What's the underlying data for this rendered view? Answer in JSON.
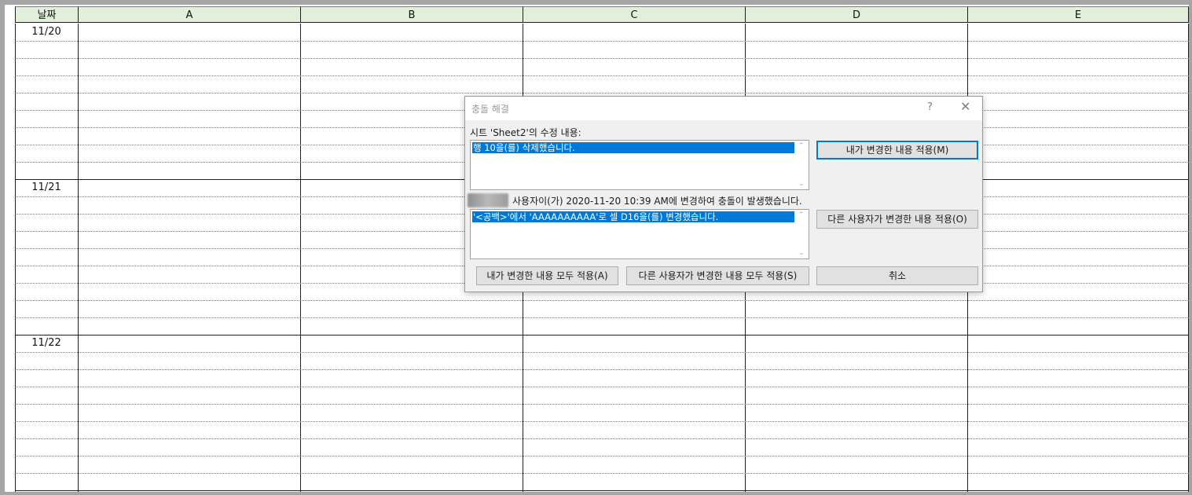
{
  "sheet": {
    "headers": [
      "날짜",
      "A",
      "B",
      "C",
      "D",
      "E"
    ],
    "dates": [
      "11/20",
      "11/21",
      "11/22"
    ]
  },
  "dialog": {
    "title": "충돌 해결",
    "help": "?",
    "close": "✕",
    "sheet_changes_label": "시트 'Sheet2'의 수정 내용:",
    "my_change_item": "행 10을(를) 삭제했습니다.",
    "conflict_message": "사용자이(가) 2020-11-20 10:39 AM에 변경하여 충돌이 발생했습니다.",
    "other_change_item": "'<공백>'에서 'AAAAAAAAAA'로 셀 D16을(를) 변경했습니다.",
    "buttons": {
      "accept_mine": "내가 변경한 내용 적용(M)",
      "accept_other": "다른 사용자가 변경한 내용 적용(O)",
      "accept_all_mine": "내가 변경한 내용 모두 적용(A)",
      "accept_all_other": "다른 사용자가 변경한 내용 모두 적용(S)",
      "cancel": "취소"
    },
    "accent_color": "#0078d7"
  }
}
